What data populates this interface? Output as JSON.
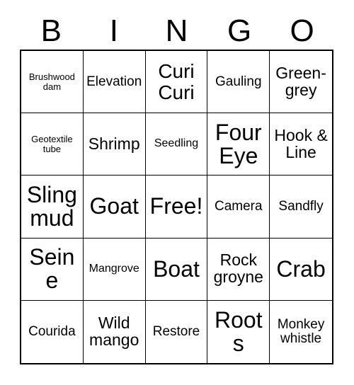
{
  "card": {
    "header_letters": [
      "B",
      "I",
      "N",
      "G",
      "O"
    ],
    "colors": {
      "background": "#ffffff",
      "text": "#000000",
      "border": "#000000"
    },
    "cells": [
      {
        "label": "Brushwood dam",
        "size": "fs-xs"
      },
      {
        "label": "Elevation",
        "size": "fs-md"
      },
      {
        "label": "Curi Curi",
        "size": "fs-xl"
      },
      {
        "label": "Gauling",
        "size": "fs-md"
      },
      {
        "label": "Green-grey",
        "size": "fs-lg"
      },
      {
        "label": "Geotextile tube",
        "size": "fs-xs"
      },
      {
        "label": "Shrimp",
        "size": "fs-lg"
      },
      {
        "label": "Seedling",
        "size": "fs-sm"
      },
      {
        "label": "Four Eye",
        "size": "fs-xxl"
      },
      {
        "label": "Hook & Line",
        "size": "fs-lg"
      },
      {
        "label": "Sling mud",
        "size": "fs-xxl"
      },
      {
        "label": "Goat",
        "size": "fs-xxl"
      },
      {
        "label": "Free!",
        "size": "fs-xxl"
      },
      {
        "label": "Camera",
        "size": "fs-md"
      },
      {
        "label": "Sandfly",
        "size": "fs-md"
      },
      {
        "label": "Seine",
        "size": "fs-xxl"
      },
      {
        "label": "Mangrove",
        "size": "fs-sm"
      },
      {
        "label": "Boat",
        "size": "fs-xxl"
      },
      {
        "label": "Rock groyne",
        "size": "fs-lg"
      },
      {
        "label": "Crab",
        "size": "fs-xxl"
      },
      {
        "label": "Courida",
        "size": "fs-md"
      },
      {
        "label": "Wild mango",
        "size": "fs-lg"
      },
      {
        "label": "Restore",
        "size": "fs-md"
      },
      {
        "label": "Roots",
        "size": "fs-xxl"
      },
      {
        "label": "Monkey whistle",
        "size": "fs-md"
      }
    ]
  }
}
